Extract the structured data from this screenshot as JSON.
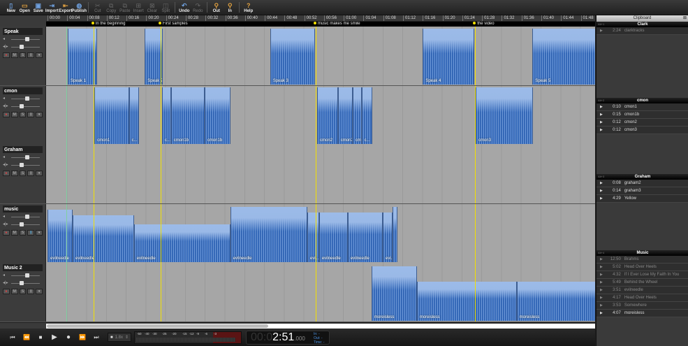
{
  "toolbar": {
    "groups": [
      [
        {
          "label": "New",
          "icon": "new-file-icon",
          "glyph": "▯"
        },
        {
          "label": "Open",
          "icon": "folder-open-icon",
          "glyph": "▭"
        },
        {
          "label": "Save",
          "icon": "save-icon",
          "glyph": "▣"
        },
        {
          "label": "Import",
          "icon": "import-icon",
          "glyph": "⇥"
        },
        {
          "label": "Export",
          "icon": "export-icon",
          "glyph": "⇤"
        },
        {
          "label": "Publish",
          "icon": "globe-icon",
          "glyph": "◍"
        }
      ],
      [
        {
          "label": "Cut",
          "icon": "scissors-icon",
          "glyph": "✂",
          "disabled": true
        },
        {
          "label": "Copy",
          "icon": "copy-icon",
          "glyph": "⧉",
          "disabled": true
        },
        {
          "label": "Paste",
          "icon": "paste-icon",
          "glyph": "⧉",
          "disabled": true
        },
        {
          "label": "Insert",
          "icon": "insert-icon",
          "glyph": "⊞",
          "disabled": true
        },
        {
          "label": "Clear",
          "icon": "clear-icon",
          "glyph": "⊠",
          "disabled": true
        },
        {
          "label": "Split",
          "icon": "split-icon",
          "glyph": "◫",
          "disabled": true
        }
      ],
      [
        {
          "label": "Undo",
          "icon": "undo-icon",
          "glyph": "↶"
        },
        {
          "label": "Redo",
          "icon": "redo-icon",
          "glyph": "↷",
          "disabled": true
        }
      ],
      [
        {
          "label": "Out",
          "icon": "zoom-out-icon",
          "glyph": "⚲"
        },
        {
          "label": "In",
          "icon": "zoom-in-icon",
          "glyph": "⚲"
        }
      ],
      [
        {
          "label": "Help",
          "icon": "help-icon",
          "glyph": "?"
        }
      ]
    ]
  },
  "ruler": {
    "labels": [
      "00:00",
      "00:04",
      "00:08",
      "00:12",
      "00:16",
      "00:20",
      "00:24",
      "00:28",
      "00:32",
      "00:36",
      "00:40",
      "00:44",
      "00:48",
      "00:52",
      "00:56",
      "01:00",
      "01:04",
      "01:08",
      "01:12",
      "01:16",
      "01:20",
      "01:24",
      "01:28",
      "01:32",
      "01:36",
      "01:40",
      "01:44",
      "01:48"
    ]
  },
  "markers": [
    {
      "label": "In the beginning",
      "time": 9.3
    },
    {
      "label": "First samples",
      "time": 22.9
    },
    {
      "label": "music makes me smile",
      "time": 54.3
    },
    {
      "label": "the video",
      "time": 86.6
    }
  ],
  "playhead_time": 3.8,
  "colors": {
    "marker": "#f3e000",
    "clip": "#9cbbe8",
    "waveform": "#3b6fbf",
    "playhead": "#7fd0a0"
  },
  "tracks": [
    {
      "name": "Speak",
      "volume": 0.85,
      "pan": 0.5,
      "clips": [
        {
          "label": "Speak 1",
          "start": 4.1,
          "end": 10.0
        },
        {
          "label": "Speak 2",
          "start": 19.7,
          "end": 23.3
        },
        {
          "label": "Speak 3",
          "start": 45.1,
          "end": 54.2
        },
        {
          "label": "Speak 4",
          "start": 76.0,
          "end": 86.4
        },
        {
          "label": "Speak 5",
          "start": 98.2,
          "end": 111
        }
      ]
    },
    {
      "name": "cmon",
      "volume": 0.85,
      "pan": 0.5,
      "clips": [
        {
          "label": "cmon1",
          "start": 9.5,
          "end": 16.5
        },
        {
          "label": "c...",
          "start": 16.5,
          "end": 18.5
        },
        {
          "label": "c...",
          "start": 23.2,
          "end": 25.0
        },
        {
          "label": "cmon1b",
          "start": 25.0,
          "end": 31.8
        },
        {
          "label": "cmon1b",
          "start": 31.8,
          "end": 37.0
        },
        {
          "label": "cmon2",
          "start": 54.6,
          "end": 58.8
        },
        {
          "label": "cmon2",
          "start": 58.8,
          "end": 61.8
        },
        {
          "label": "cm...",
          "start": 61.8,
          "end": 63.6
        },
        {
          "label": "c...",
          "start": 63.6,
          "end": 65.8
        },
        {
          "label": "cmon3",
          "start": 86.7,
          "end": 98.3
        }
      ]
    },
    {
      "name": "Graham",
      "volume": 0.85,
      "pan": 0.5,
      "clips": []
    },
    {
      "name": "music",
      "volume": 0.85,
      "pan": 0.5,
      "clips": [
        {
          "label": "evilneedle",
          "start": 0,
          "end": 5.1,
          "level": 0.9
        },
        {
          "label": "evilneedle",
          "start": 5.1,
          "end": 17.5,
          "level": 0.8
        },
        {
          "label": "evilneedle",
          "start": 17.5,
          "end": 37.0,
          "level": 0.65
        },
        {
          "label": "evilneedle",
          "start": 37.0,
          "end": 52.6,
          "level": 0.95
        },
        {
          "label": "evil...",
          "start": 52.6,
          "end": 55.0,
          "level": 0.85
        },
        {
          "label": "evilneedle",
          "start": 55.0,
          "end": 60.8,
          "level": 0.85
        },
        {
          "label": "evilneedle",
          "start": 60.8,
          "end": 67.9,
          "level": 0.85
        },
        {
          "label": "evi...",
          "start": 67.9,
          "end": 69.9,
          "level": 0.85
        },
        {
          "label": "",
          "start": 69.9,
          "end": 70.9,
          "level": 0.95
        }
      ]
    },
    {
      "name": "Music 2",
      "volume": 0.85,
      "pan": 0.5,
      "clips": [
        {
          "label": "moreisless",
          "start": 65.6,
          "end": 74.8,
          "level": 0.95
        },
        {
          "label": "moreisless",
          "start": 74.8,
          "end": 95.0,
          "level": 0.68
        },
        {
          "label": "moreisless",
          "start": 95.0,
          "end": 111,
          "level": 0.68
        }
      ]
    }
  ],
  "track_buttons": [
    "●",
    "M",
    "S",
    "⫼",
    "▾"
  ],
  "transport": {
    "speed": "1.8x",
    "meter_scale": [
      "-50",
      "-40",
      "-30",
      "-25",
      "-20",
      "-15",
      "-12",
      "-9",
      "-6",
      "-3"
    ],
    "clock_dim": "00:0",
    "clock_main": "2:51",
    "clock_ms": ".000",
    "in_label": "In:",
    "out_label": "Out:",
    "time_label": "Time:",
    "in_value": "-",
    "out_value": "-",
    "time_value": "-"
  },
  "clipboard": {
    "title": "Clipboard",
    "groups": [
      {
        "name": "Clark",
        "alt": "Alt+1",
        "items": [
          {
            "duration": "2:24",
            "name": "clarktracks",
            "dim": true
          }
        ]
      },
      {
        "name": "cmon",
        "alt": "Alt+2",
        "items": [
          {
            "duration": "0:10",
            "name": "cmon1"
          },
          {
            "duration": "0:15",
            "name": "cmon1b"
          },
          {
            "duration": "0:12",
            "name": "cmon2"
          },
          {
            "duration": "0:12",
            "name": "cmon3"
          }
        ]
      },
      {
        "name": "Graham",
        "alt": "Alt+3",
        "items": [
          {
            "duration": "0:08",
            "name": "graham2"
          },
          {
            "duration": "0:14",
            "name": "graham3"
          },
          {
            "duration": "4:29",
            "name": "Yellow"
          }
        ]
      },
      {
        "name": "Music",
        "alt": "Alt+4",
        "items": [
          {
            "duration": "12:50",
            "name": "Brahms",
            "dim": true
          },
          {
            "duration": "5:02",
            "name": "Head Over Heels",
            "dim": true
          },
          {
            "duration": "4:32",
            "name": "If I Ever Lose My Faith In You",
            "dim": true
          },
          {
            "duration": "5:49",
            "name": "Behind the Wheel",
            "dim": true
          },
          {
            "duration": "3:51",
            "name": "evilneedle",
            "dim": true
          },
          {
            "duration": "4:17",
            "name": "Head Over Heels",
            "dim": true
          },
          {
            "duration": "3:53",
            "name": "Somewhere",
            "dim": true
          },
          {
            "duration": "4:07",
            "name": "moreisless"
          }
        ]
      }
    ]
  }
}
